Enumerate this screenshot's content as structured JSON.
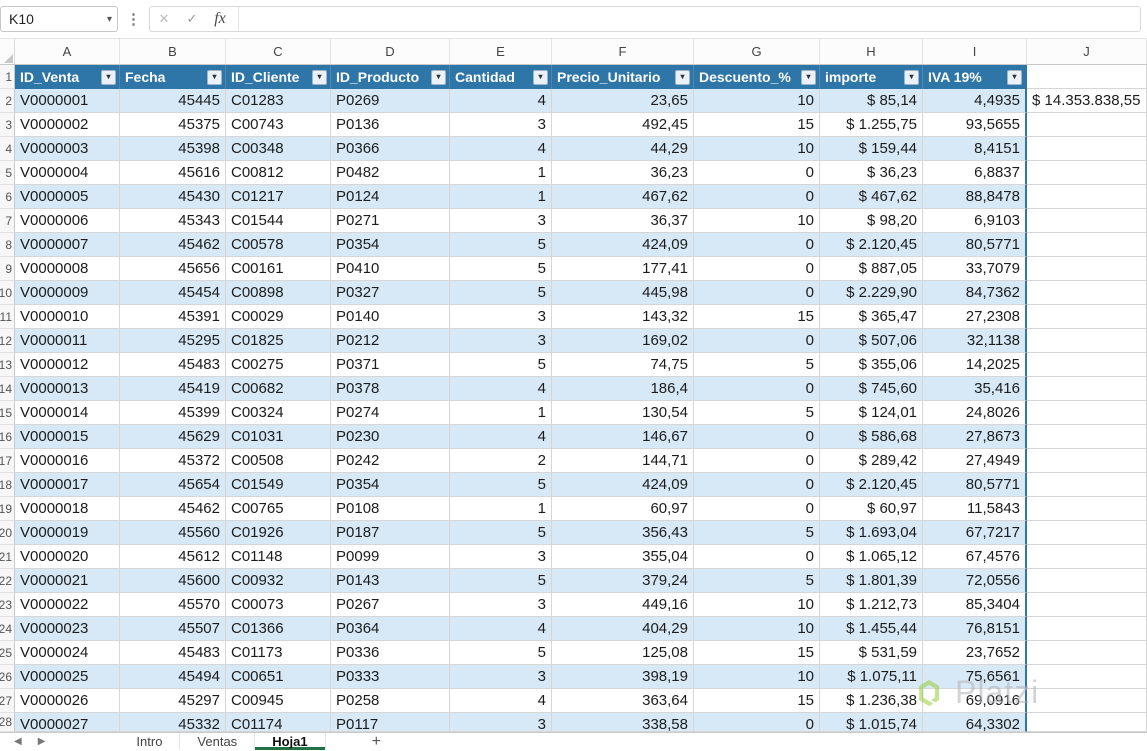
{
  "formula_bar": {
    "name_box": "K10",
    "chevron_icon": "▾",
    "dots_icon": "⋮",
    "cancel_icon": "✕",
    "check_icon": "✓",
    "fx_label": "fx",
    "formula_value": ""
  },
  "column_letters": [
    "A",
    "B",
    "C",
    "D",
    "E",
    "F",
    "G",
    "H",
    "I",
    "J"
  ],
  "row_numbers": [
    "1",
    "2",
    "3",
    "4",
    "5",
    "6",
    "7",
    "8",
    "9",
    "10",
    "11",
    "12",
    "13",
    "14",
    "15",
    "16",
    "17",
    "18",
    "19",
    "20",
    "21",
    "22",
    "23",
    "24",
    "25",
    "26",
    "27",
    "28"
  ],
  "table": {
    "headers": [
      "ID_Venta",
      "Fecha",
      "ID_Cliente",
      "ID_Producto",
      "Cantidad",
      "Precio_Unitario",
      "Descuento_%",
      "importe",
      "IVA 19%"
    ],
    "rows": [
      [
        "V0000001",
        "45445",
        "C01283",
        "P0269",
        "4",
        "23,65",
        "10",
        "$ 85,14",
        "4,4935"
      ],
      [
        "V0000002",
        "45375",
        "C00743",
        "P0136",
        "3",
        "492,45",
        "15",
        "$ 1.255,75",
        "93,5655"
      ],
      [
        "V0000003",
        "45398",
        "C00348",
        "P0366",
        "4",
        "44,29",
        "10",
        "$ 159,44",
        "8,4151"
      ],
      [
        "V0000004",
        "45616",
        "C00812",
        "P0482",
        "1",
        "36,23",
        "0",
        "$ 36,23",
        "6,8837"
      ],
      [
        "V0000005",
        "45430",
        "C01217",
        "P0124",
        "1",
        "467,62",
        "0",
        "$ 467,62",
        "88,8478"
      ],
      [
        "V0000006",
        "45343",
        "C01544",
        "P0271",
        "3",
        "36,37",
        "10",
        "$ 98,20",
        "6,9103"
      ],
      [
        "V0000007",
        "45462",
        "C00578",
        "P0354",
        "5",
        "424,09",
        "0",
        "$ 2.120,45",
        "80,5771"
      ],
      [
        "V0000008",
        "45656",
        "C00161",
        "P0410",
        "5",
        "177,41",
        "0",
        "$ 887,05",
        "33,7079"
      ],
      [
        "V0000009",
        "45454",
        "C00898",
        "P0327",
        "5",
        "445,98",
        "0",
        "$ 2.229,90",
        "84,7362"
      ],
      [
        "V0000010",
        "45391",
        "C00029",
        "P0140",
        "3",
        "143,32",
        "15",
        "$ 365,47",
        "27,2308"
      ],
      [
        "V0000011",
        "45295",
        "C01825",
        "P0212",
        "3",
        "169,02",
        "0",
        "$ 507,06",
        "32,1138"
      ],
      [
        "V0000012",
        "45483",
        "C00275",
        "P0371",
        "5",
        "74,75",
        "5",
        "$ 355,06",
        "14,2025"
      ],
      [
        "V0000013",
        "45419",
        "C00682",
        "P0378",
        "4",
        "186,4",
        "0",
        "$ 745,60",
        "35,416"
      ],
      [
        "V0000014",
        "45399",
        "C00324",
        "P0274",
        "1",
        "130,54",
        "5",
        "$ 124,01",
        "24,8026"
      ],
      [
        "V0000015",
        "45629",
        "C01031",
        "P0230",
        "4",
        "146,67",
        "0",
        "$ 586,68",
        "27,8673"
      ],
      [
        "V0000016",
        "45372",
        "C00508",
        "P0242",
        "2",
        "144,71",
        "0",
        "$ 289,42",
        "27,4949"
      ],
      [
        "V0000017",
        "45654",
        "C01549",
        "P0354",
        "5",
        "424,09",
        "0",
        "$ 2.120,45",
        "80,5771"
      ],
      [
        "V0000018",
        "45462",
        "C00765",
        "P0108",
        "1",
        "60,97",
        "0",
        "$ 60,97",
        "11,5843"
      ],
      [
        "V0000019",
        "45560",
        "C01926",
        "P0187",
        "5",
        "356,43",
        "5",
        "$ 1.693,04",
        "67,7217"
      ],
      [
        "V0000020",
        "45612",
        "C01148",
        "P0099",
        "3",
        "355,04",
        "0",
        "$ 1.065,12",
        "67,4576"
      ],
      [
        "V0000021",
        "45600",
        "C00932",
        "P0143",
        "5",
        "379,24",
        "5",
        "$ 1.801,39",
        "72,0556"
      ],
      [
        "V0000022",
        "45570",
        "C00073",
        "P0267",
        "3",
        "449,16",
        "10",
        "$ 1.212,73",
        "85,3404"
      ],
      [
        "V0000023",
        "45507",
        "C01366",
        "P0364",
        "4",
        "404,29",
        "10",
        "$ 1.455,44",
        "76,8151"
      ],
      [
        "V0000024",
        "45483",
        "C01173",
        "P0336",
        "5",
        "125,08",
        "15",
        "$ 531,59",
        "23,7652"
      ],
      [
        "V0000025",
        "45494",
        "C00651",
        "P0333",
        "3",
        "398,19",
        "10",
        "$ 1.075,11",
        "75,6561"
      ],
      [
        "V0000026",
        "45297",
        "C00945",
        "P0258",
        "4",
        "363,64",
        "15",
        "$ 1.236,38",
        "69,0916"
      ],
      [
        "V0000027",
        "45332",
        "C01174",
        "P0117",
        "3",
        "338,58",
        "0",
        "$ 1.015,74",
        "64,3302"
      ]
    ],
    "j2_value": "$ 14.353.838,55"
  },
  "sheet_tabs": {
    "nav_left": "◀",
    "nav_right": "▶",
    "items": [
      {
        "label": "Intro",
        "active": false
      },
      {
        "label": "Ventas",
        "active": false
      },
      {
        "label": "Hoja1",
        "active": true
      }
    ],
    "add_label": "+"
  },
  "watermark": {
    "text": "Platzi"
  },
  "colors": {
    "table_header_bg": "#2E75A8",
    "band_row_bg": "#D7E9F6",
    "table_border": "#2E75A8",
    "active_tab_accent": "#217346",
    "watermark_green": "#9BCB3C"
  }
}
